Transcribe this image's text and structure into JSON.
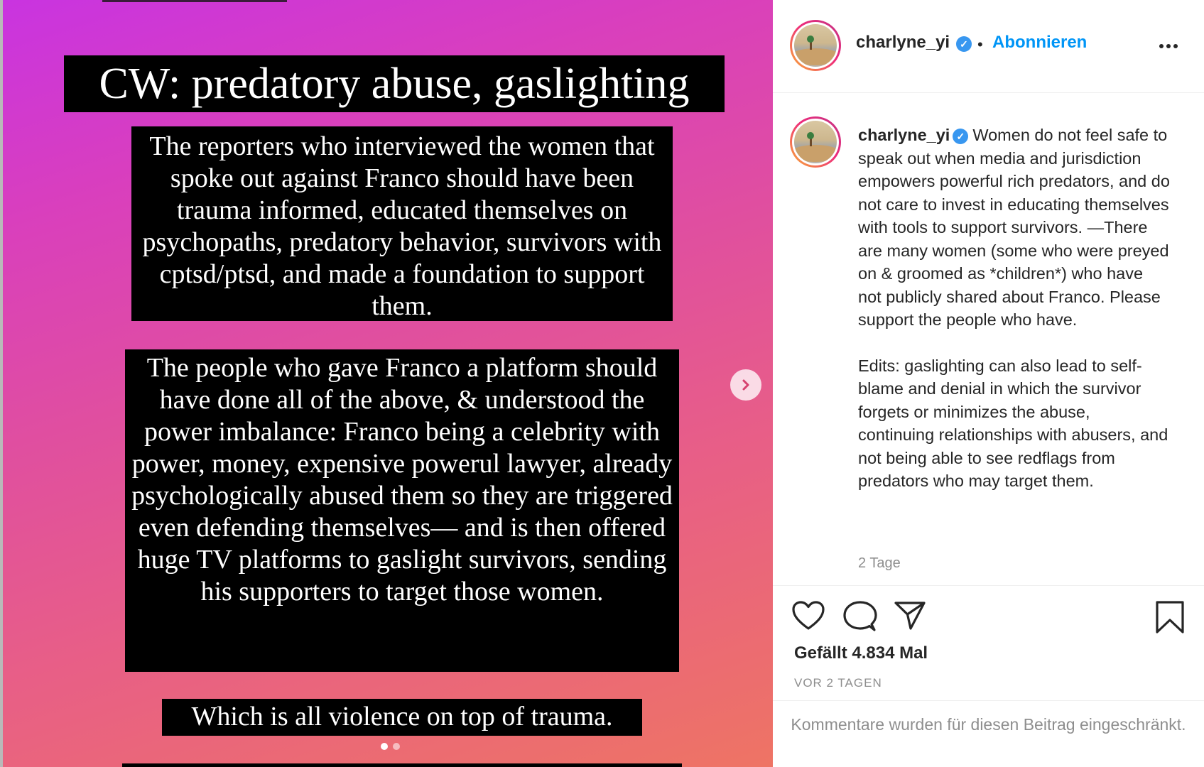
{
  "post": {
    "slides": {
      "heading": "CW: predatory abuse, gaslighting",
      "paragraph_1": "The reporters who interviewed the women that spoke out against Franco should have been trauma informed, educated themselves on psychopaths, predatory behavior, survivors with cptsd/ptsd, and made a foundation to support them.",
      "paragraph_2": "The people who gave Franco a platform should have done all of the above, & understood the power imbalance: Franco being a celebrity with power, money, expensive powerul lawyer, already psychologically abused them so they are triggered even defending themselves— and is then  offered  huge TV platforms to gaslight survivors,  sending his supporters to target those women.",
      "paragraph_3": "Which is all violence on top of trauma.",
      "slide_count": 2,
      "current_slide": 1
    },
    "header": {
      "username": "charlyne_yi",
      "verified": true,
      "separator": "•",
      "follow_label": "Abonnieren",
      "more_icon": "more-horizontal-icon"
    },
    "caption": {
      "username": "charlyne_yi",
      "text": "Women do not feel safe to speak out when media and jurisdiction empowers powerful rich predators, and do not care to invest in educating themselves with tools to support survivors. —There are many women (some who were preyed on & groomed as *children*) who have not publicly shared about Franco. Please support the people who have.",
      "edit_text": "Edits: gaslighting can also lead to self-blame and denial in which the survivor forgets or minimizes the abuse, continuing relationships with abusers, and not being able to see redflags from predators who may target them.",
      "age": "2 Tage"
    },
    "actions": {
      "like_icon": "heart-icon",
      "comment_icon": "comment-icon",
      "share_icon": "paper-plane-icon",
      "save_icon": "bookmark-icon"
    },
    "likes_text": "Gefällt 4.834 Mal",
    "date_text": "VOR 2 TAGEN",
    "comments_disabled_text": "Kommentare wurden für diesen Beitrag eingeschränkt."
  },
  "colors": {
    "accent_blue": "#0095f6",
    "verified_blue": "#3897f0",
    "muted_text": "#8e8e8e",
    "gradient_start": "#c934e0",
    "gradient_end": "#ee7464"
  }
}
